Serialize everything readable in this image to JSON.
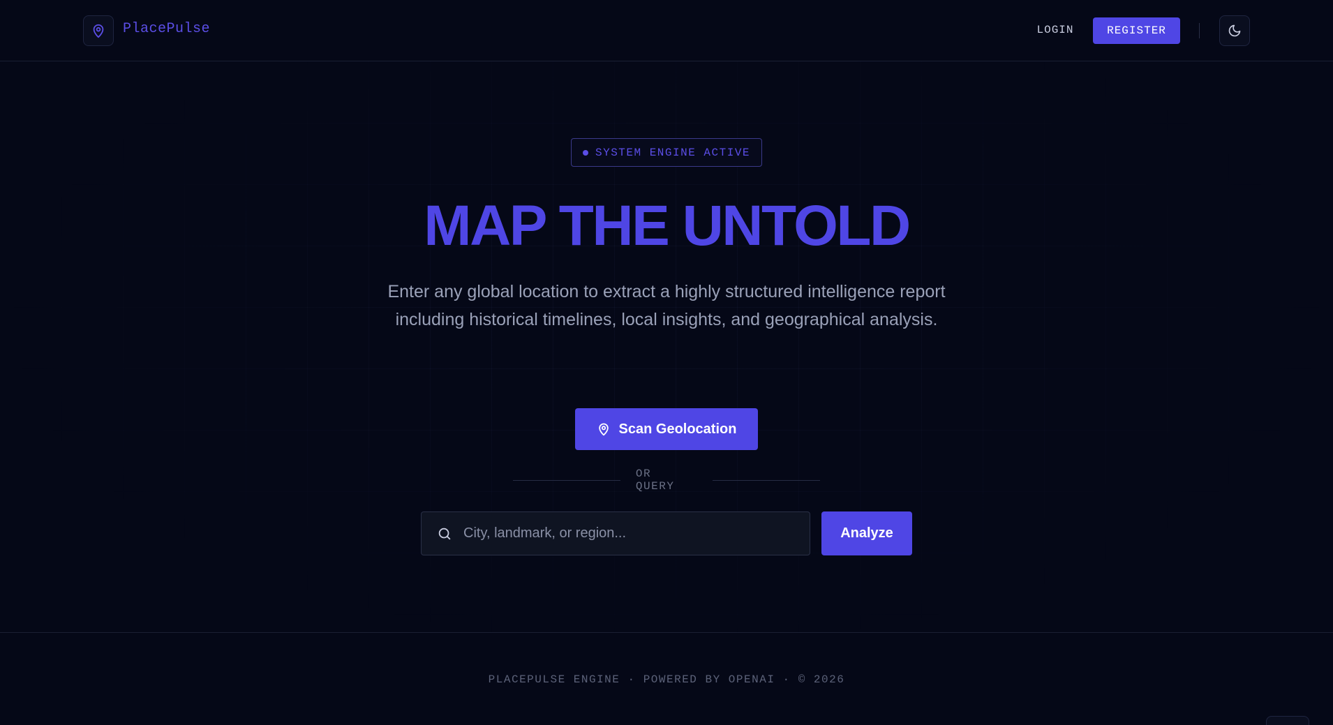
{
  "header": {
    "brand": "PlacePulse",
    "login_label": "LOGIN",
    "register_label": "REGISTER",
    "logo_icon": "map-pin-icon",
    "theme_icon": "moon-icon"
  },
  "hero": {
    "badge": "SYSTEM ENGINE ACTIVE",
    "title": "MAP THE UNTOLD",
    "subtitle": "Enter any global location to extract a highly structured intelligence report including historical timelines, local insights, and geographical analysis.",
    "scan_label": "Scan Geolocation",
    "divider_label": "OR QUERY"
  },
  "search": {
    "placeholder": "City, landmark, or region...",
    "value": "",
    "submit_label": "Analyze"
  },
  "footer": {
    "text": "PLACEPULSE ENGINE · POWERED BY OPENAI · © 2026"
  },
  "colors": {
    "background": "#050817",
    "accent": "#4f46e5",
    "muted_text": "#9aa1b8"
  }
}
